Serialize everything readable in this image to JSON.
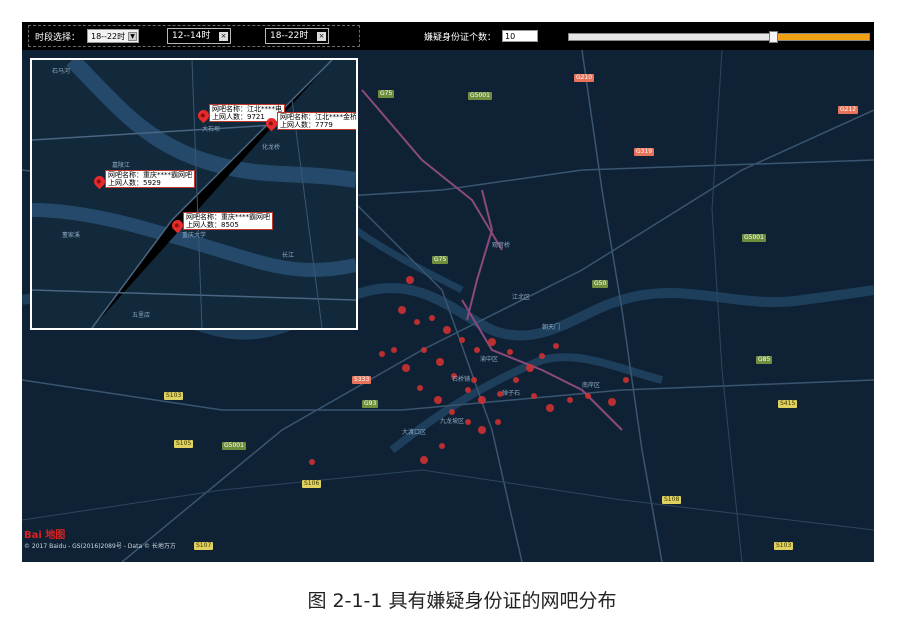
{
  "toolbar": {
    "time_label": "时段选择：",
    "time_select": "18--22时",
    "chips": [
      "12--14时",
      "18--22时"
    ],
    "count_label": "嫌疑身份证个数：",
    "count_value": "10",
    "slider_fraction": 0.68,
    "slider_color": "#f0a010"
  },
  "inset_popups": [
    {
      "name": "网吧名称：江北****电",
      "count": "上网人数：9721"
    },
    {
      "name": "网吧名称：江北****金桥",
      "count": "上网人数：7779"
    },
    {
      "name": "网吧名称：重庆****霸网吧",
      "count": "上网人数：5929"
    },
    {
      "name": "网吧名称：重庆****霸网吧",
      "count": "上网人数：8505"
    }
  ],
  "places": [
    "江北区",
    "渝中区",
    "大渡口区",
    "九龙坡区",
    "石桥铺",
    "南岸区",
    "弹子石",
    "观音桥",
    "朝天门"
  ],
  "inset_places": [
    "石马河",
    "大石坝",
    "董家溪",
    "重庆大学",
    "化龙桥",
    "五里店",
    "嘉陵江",
    "长江"
  ],
  "shields": {
    "green": [
      "G75",
      "G5001",
      "G50",
      "G93",
      "G5001",
      "G85",
      "G5001",
      "G75"
    ],
    "yellow": [
      "S103",
      "S105",
      "S106",
      "S108",
      "S107",
      "S415",
      "S103"
    ],
    "red": [
      "G210",
      "G319",
      "G212",
      "S333"
    ]
  },
  "map_footer": {
    "logo": "Bai 地图",
    "copyright": "© 2017 Baidu - GS(2016)2089号 - Data © 长地万方"
  },
  "caption": "图 2-1-1  具有嫌疑身份证的网吧分布"
}
